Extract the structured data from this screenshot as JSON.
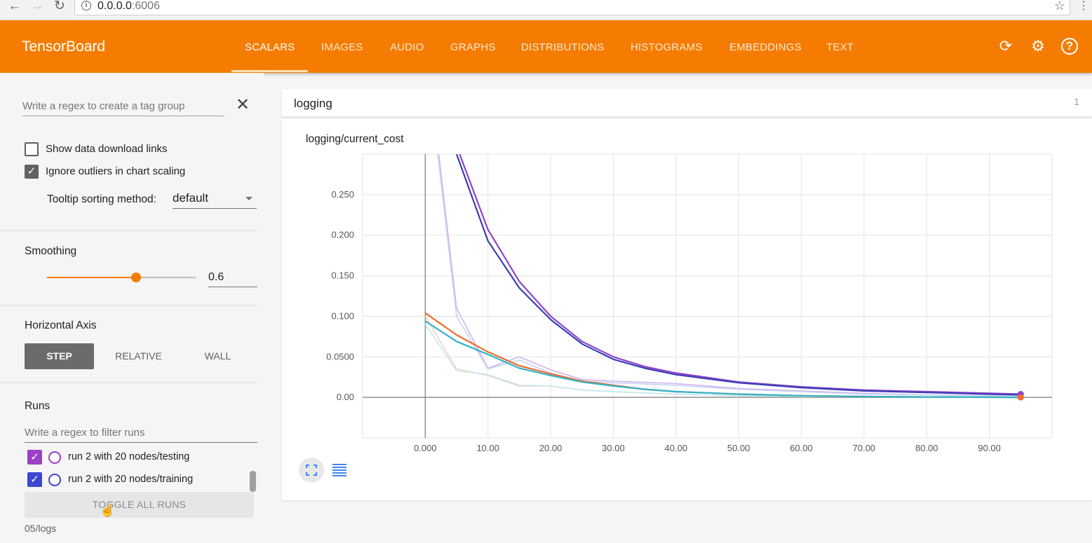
{
  "browser": {
    "back_glyph": "←",
    "forward_glyph": "→",
    "reload_glyph": "↻",
    "info_glyph": "i",
    "url_host": "0.0.0.0",
    "url_port": ":6006",
    "star_glyph": "☆",
    "menu_glyph": "⋮"
  },
  "header": {
    "title": "TensorBoard",
    "tabs": [
      {
        "label": "SCALARS",
        "active": true
      },
      {
        "label": "IMAGES"
      },
      {
        "label": "AUDIO"
      },
      {
        "label": "GRAPHS"
      },
      {
        "label": "DISTRIBUTIONS"
      },
      {
        "label": "HISTOGRAMS"
      },
      {
        "label": "EMBEDDINGS"
      },
      {
        "label": "TEXT"
      }
    ],
    "icons": {
      "reload": "refresh-icon",
      "settings": "gear-icon",
      "help": "help-icon"
    },
    "reload_glyph": "⟳",
    "settings_glyph": "⚙",
    "help_glyph": "?",
    "accent": "#f57c00"
  },
  "sidebar": {
    "tag_group_placeholder": "Write a regex to create a tag group",
    "close_glyph": "✕",
    "check_glyph": "✓",
    "show_download_links": {
      "label": "Show data download links",
      "checked": false
    },
    "ignore_outliers": {
      "label": "Ignore outliers in chart scaling",
      "checked": true
    },
    "tooltip_sorting": {
      "label": "Tooltip sorting method:",
      "value": "default"
    },
    "smoothing": {
      "title": "Smoothing",
      "value": "0.6",
      "fraction": 0.6
    },
    "horizontal_axis": {
      "title": "Horizontal Axis",
      "options": [
        {
          "label": "STEP",
          "active": true
        },
        {
          "label": "RELATIVE"
        },
        {
          "label": "WALL"
        }
      ]
    },
    "runs": {
      "title": "Runs",
      "filter_placeholder": "Write a regex to filter runs",
      "items": [
        {
          "label": "run 2 with 20 nodes/testing",
          "color": "#9c3fc7",
          "checked": true
        },
        {
          "label": "run 2 with 20 nodes/training",
          "color": "#3b46d1",
          "checked": true
        }
      ],
      "toggle_label": "TOGGLE ALL RUNS"
    },
    "logdir": "05/logs"
  },
  "main": {
    "group_title": "logging",
    "group_count": "1",
    "chart_title": "logging/current_cost"
  },
  "chart_data": {
    "type": "line",
    "title": "logging/current_cost",
    "xlabel": "",
    "ylabel": "",
    "xlim": [
      -10,
      100
    ],
    "ylim": [
      -0.05,
      0.3
    ],
    "x_ticks": [
      0,
      10,
      20,
      30,
      40,
      50,
      60,
      70,
      80,
      90
    ],
    "x_tick_labels": [
      "0.000",
      "10.00",
      "20.00",
      "30.00",
      "40.00",
      "50.00",
      "60.00",
      "70.00",
      "80.00",
      "90.00"
    ],
    "y_ticks": [
      0,
      0.05,
      0.1,
      0.15,
      0.2,
      0.25
    ],
    "y_tick_labels": [
      "0.00",
      "0.0500",
      "0.100",
      "0.150",
      "0.200",
      "0.250"
    ],
    "grid": true,
    "series": [
      {
        "color": "#8e44c9",
        "smoothed": true,
        "x": [
          5,
          10,
          15,
          20,
          25,
          30,
          35,
          40,
          50,
          60,
          70,
          80,
          95
        ],
        "y": [
          0.31,
          0.207,
          0.143,
          0.1,
          0.069,
          0.05,
          0.038,
          0.03,
          0.019,
          0.013,
          0.009,
          0.007,
          0.004
        ]
      },
      {
        "color": "#3b3fb5",
        "smoothed": true,
        "x": [
          5,
          10,
          15,
          20,
          25,
          30,
          35,
          40,
          50,
          60,
          70,
          80,
          95
        ],
        "y": [
          0.3,
          0.193,
          0.135,
          0.096,
          0.066,
          0.047,
          0.036,
          0.028,
          0.018,
          0.012,
          0.008,
          0.006,
          0.003
        ]
      },
      {
        "color": "#f26b2c",
        "smoothed": true,
        "x": [
          0,
          5,
          10,
          15,
          20,
          25,
          30,
          35,
          40,
          50,
          60,
          70,
          80,
          95
        ],
        "y": [
          0.104,
          0.077,
          0.056,
          0.039,
          0.029,
          0.02,
          0.015,
          0.01,
          0.007,
          0.004,
          0.002,
          0.001,
          0.0005,
          0.0
        ]
      },
      {
        "color": "#2fb4c9",
        "smoothed": true,
        "x": [
          0,
          5,
          10,
          15,
          20,
          25,
          30,
          35,
          40,
          50,
          60,
          70,
          80,
          95
        ],
        "y": [
          0.094,
          0.069,
          0.053,
          0.036,
          0.027,
          0.019,
          0.014,
          0.01,
          0.007,
          0.004,
          0.002,
          0.001,
          0.0005,
          0.0
        ]
      },
      {
        "color": "#cfb4ef",
        "smoothed": false,
        "x": [
          2,
          5,
          10,
          15,
          20,
          25,
          30,
          40,
          50,
          60,
          70,
          80,
          95
        ],
        "y": [
          0.31,
          0.11,
          0.036,
          0.05,
          0.034,
          0.022,
          0.02,
          0.017,
          0.011,
          0.008,
          0.005,
          0.003,
          0.002
        ]
      },
      {
        "color": "#c9d2f2",
        "smoothed": false,
        "x": [
          2,
          5,
          10,
          15,
          20,
          25,
          30,
          40,
          50,
          60,
          70,
          80,
          95
        ],
        "y": [
          0.3,
          0.1,
          0.035,
          0.046,
          0.03,
          0.02,
          0.018,
          0.015,
          0.01,
          0.007,
          0.004,
          0.003,
          0.002
        ]
      },
      {
        "color": "#f8cfc0",
        "smoothed": false,
        "x": [
          0,
          5,
          10,
          15,
          20,
          25,
          30,
          40,
          50,
          60,
          70,
          80,
          95
        ],
        "y": [
          0.1,
          0.035,
          0.027,
          0.014,
          0.014,
          0.009,
          0.007,
          0.004,
          0.002,
          0.001,
          0.001,
          0.0,
          0.0
        ]
      },
      {
        "color": "#bfe9ef",
        "smoothed": false,
        "x": [
          0,
          5,
          10,
          15,
          20,
          25,
          30,
          40,
          50,
          60,
          70,
          80,
          95
        ],
        "y": [
          0.09,
          0.033,
          0.028,
          0.015,
          0.014,
          0.009,
          0.007,
          0.004,
          0.002,
          0.001,
          0.001,
          0.0,
          0.0
        ]
      }
    ],
    "end_markers": [
      {
        "x": 95,
        "y": 0.004,
        "color": "#8e44c9"
      },
      {
        "x": 95,
        "y": 0.0,
        "color": "#f26b2c"
      }
    ]
  }
}
